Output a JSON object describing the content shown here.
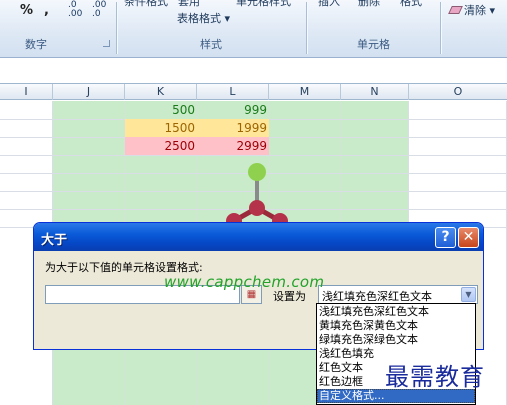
{
  "ribbon": {
    "number_group_label": "数字",
    "styles_group_label": "样式",
    "cells_group_label": "单元格",
    "table_format_label": "表格格式",
    "percent_icon": "%",
    "comma_icon": ",",
    "increase_decimal_label": ".0 .00",
    "decrease_decimal_label": ".00 .0",
    "clear_label": "清除",
    "eraser_icon": "eraser-icon"
  },
  "columns": [
    "I",
    "J",
    "K",
    "L",
    "M",
    "N",
    "O"
  ],
  "cells": [
    {
      "k": "500",
      "l": "999",
      "fill": ""
    },
    {
      "k": "1500",
      "l": "1999",
      "fill": "#ffe699"
    },
    {
      "k": "2500",
      "l": "2999",
      "fill": "#ffc1c8"
    }
  ],
  "colors": {
    "highlight_green": "#c9ebc9",
    "yellow_fill": "#ffe699",
    "red_fill": "#ffc1c8"
  },
  "dialog": {
    "title": "大于",
    "help_button": "?",
    "close_button": "✕",
    "prompt": "为大于以下值的单元格设置格式:",
    "range_value": "",
    "set_as_label": "设置为",
    "selected_format": "浅红填充色深红色文本",
    "format_options": [
      "浅红填充色深红色文本",
      "黄填充色深黄色文本",
      "绿填充色深绿色文本",
      "浅红色填充",
      "红色文本",
      "红色边框",
      "自定义格式..."
    ],
    "highlighted_option_index": 6
  },
  "watermark": {
    "site": "www.cappchem.com",
    "logo_text": "最需教育"
  }
}
